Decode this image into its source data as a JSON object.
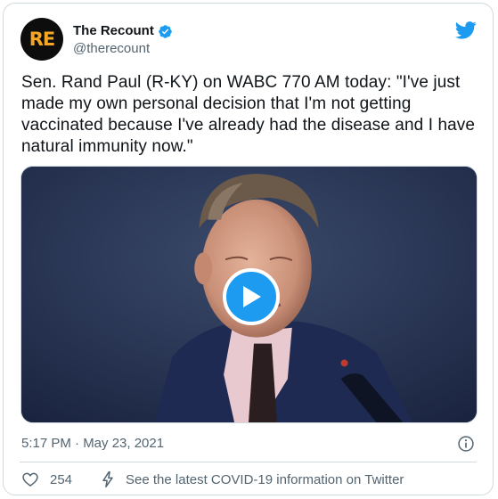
{
  "account": {
    "avatar_text": "RE",
    "display_name": "The Recount",
    "handle": "@therecount",
    "verified": true
  },
  "tweet": {
    "text": "Sen. Rand Paul (R-KY) on WABC 770 AM today: \"I've just made my own personal decision that I'm not getting vaccinated because I've already had the disease and I have natural immunity now.\"",
    "timestamp": "5:17 PM · May 23, 2021"
  },
  "media": {
    "type": "video",
    "play_icon": "play-icon"
  },
  "actions": {
    "like_count": "254",
    "covid_info": "See the latest COVID-19 information on Twitter"
  },
  "icons": {
    "brand": "twitter-bird-icon",
    "verified": "verified-badge-icon",
    "info": "info-icon",
    "like": "heart-icon",
    "covid": "lightning-icon"
  },
  "colors": {
    "brand_blue": "#1d9bf0",
    "text_primary": "#0f1419",
    "text_secondary": "#536471",
    "border": "#cfd9de",
    "avatar_bg": "#0d0d0d",
    "avatar_text": "#f5a623"
  }
}
